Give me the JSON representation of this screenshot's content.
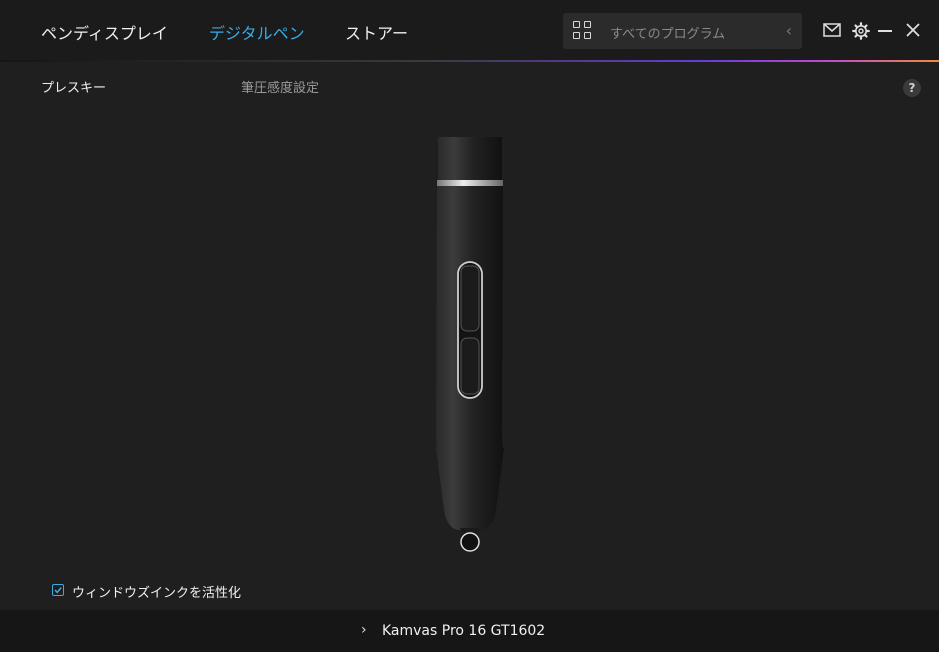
{
  "nav": {
    "tabs": [
      {
        "label": "ペンディスプレイ"
      },
      {
        "label": "デジタルペン"
      },
      {
        "label": "ストアー"
      }
    ]
  },
  "search": {
    "placeholder": "すべてのプログラム"
  },
  "subtabs": {
    "press_key": "プレスキー",
    "pressure": "筆圧感度設定"
  },
  "help": {
    "label": "?"
  },
  "settings": {
    "windows_ink_label": "ウィンドウズインクを活性化",
    "windows_ink_checked": true
  },
  "device": {
    "name": "Kamvas Pro 16 GT1602"
  },
  "colors": {
    "accent": "#39a9e6",
    "background": "#1f1f1f",
    "topbar": "#1b1b1b",
    "bottom_bar": "#161616"
  }
}
